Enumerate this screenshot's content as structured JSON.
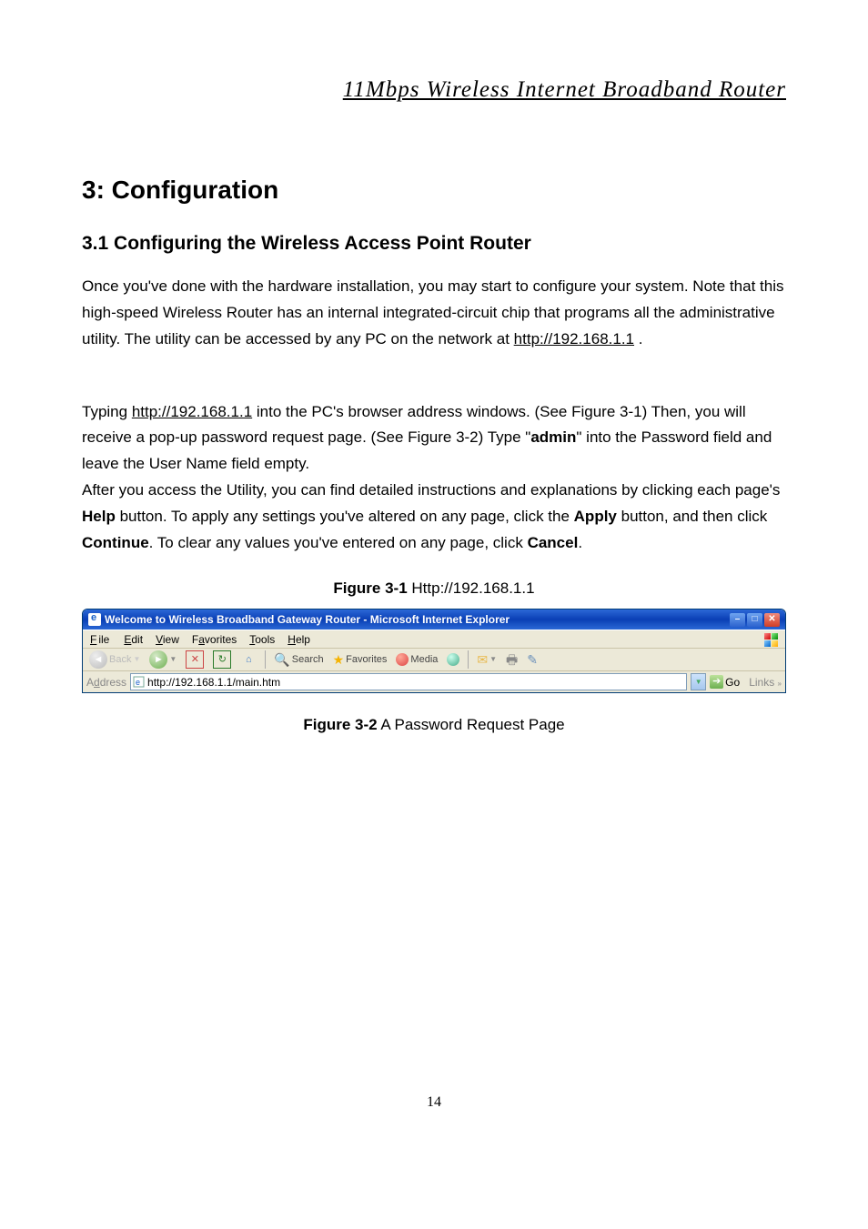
{
  "doc_header": "11Mbps  Wireless  Internet  Broadband  Router",
  "h1": "3: Configuration",
  "h2": "3.1 Configuring the Wireless Access Point Router",
  "para1_pre": "Once you've done with the hardware installation, you may start to configure your system. Note that this high-speed Wireless Router has an internal integrated-circuit chip that programs all the administrative utility. The utility can be accessed by any PC on the network at ",
  "url1": "http://192.168.1.1",
  "para1_post": " .",
  "para2_pre": "Typing ",
  "url2": "http://192.168.1.1",
  "para2_mid1": " into the PC's browser address windows. (See Figure 3-1) Then, you will receive a pop-up password request page. (See Figure 3-2) Type \"",
  "bold_admin": "admin",
  "para2_mid2": "\" into the Password field and leave the User Name field empty.\nAfter you access the Utility, you can find detailed instructions and explanations by clicking each page's ",
  "bold_help": "Help",
  "para2_mid3": " button. To apply any settings you've altered on any page, click the ",
  "bold_apply": "Apply",
  "para2_mid4": " button, and then click ",
  "bold_continue": "Continue",
  "para2_mid5": ". To clear any values you've entered on any page, click ",
  "bold_cancel": "Cancel",
  "para2_post": ".",
  "figure1_label": "Figure 3-1",
  "figure1_text": " Http://192.168.1.1",
  "figure2_label": "Figure 3-2",
  "figure2_text": " A Password Request Page",
  "page_number": "14",
  "ie": {
    "title": "Welcome to Wireless Broadband Gateway Router - Microsoft Internet Explorer",
    "menu": {
      "file": "File",
      "edit": "Edit",
      "view": "View",
      "favorites": "Favorites",
      "tools": "Tools",
      "help": "Help"
    },
    "toolbar": {
      "back": "Back",
      "search": "Search",
      "favorites": "Favorites",
      "media": "Media"
    },
    "address_label": "Address",
    "address_value": "http://192.168.1.1/main.htm",
    "go": "Go",
    "links": "Links"
  }
}
